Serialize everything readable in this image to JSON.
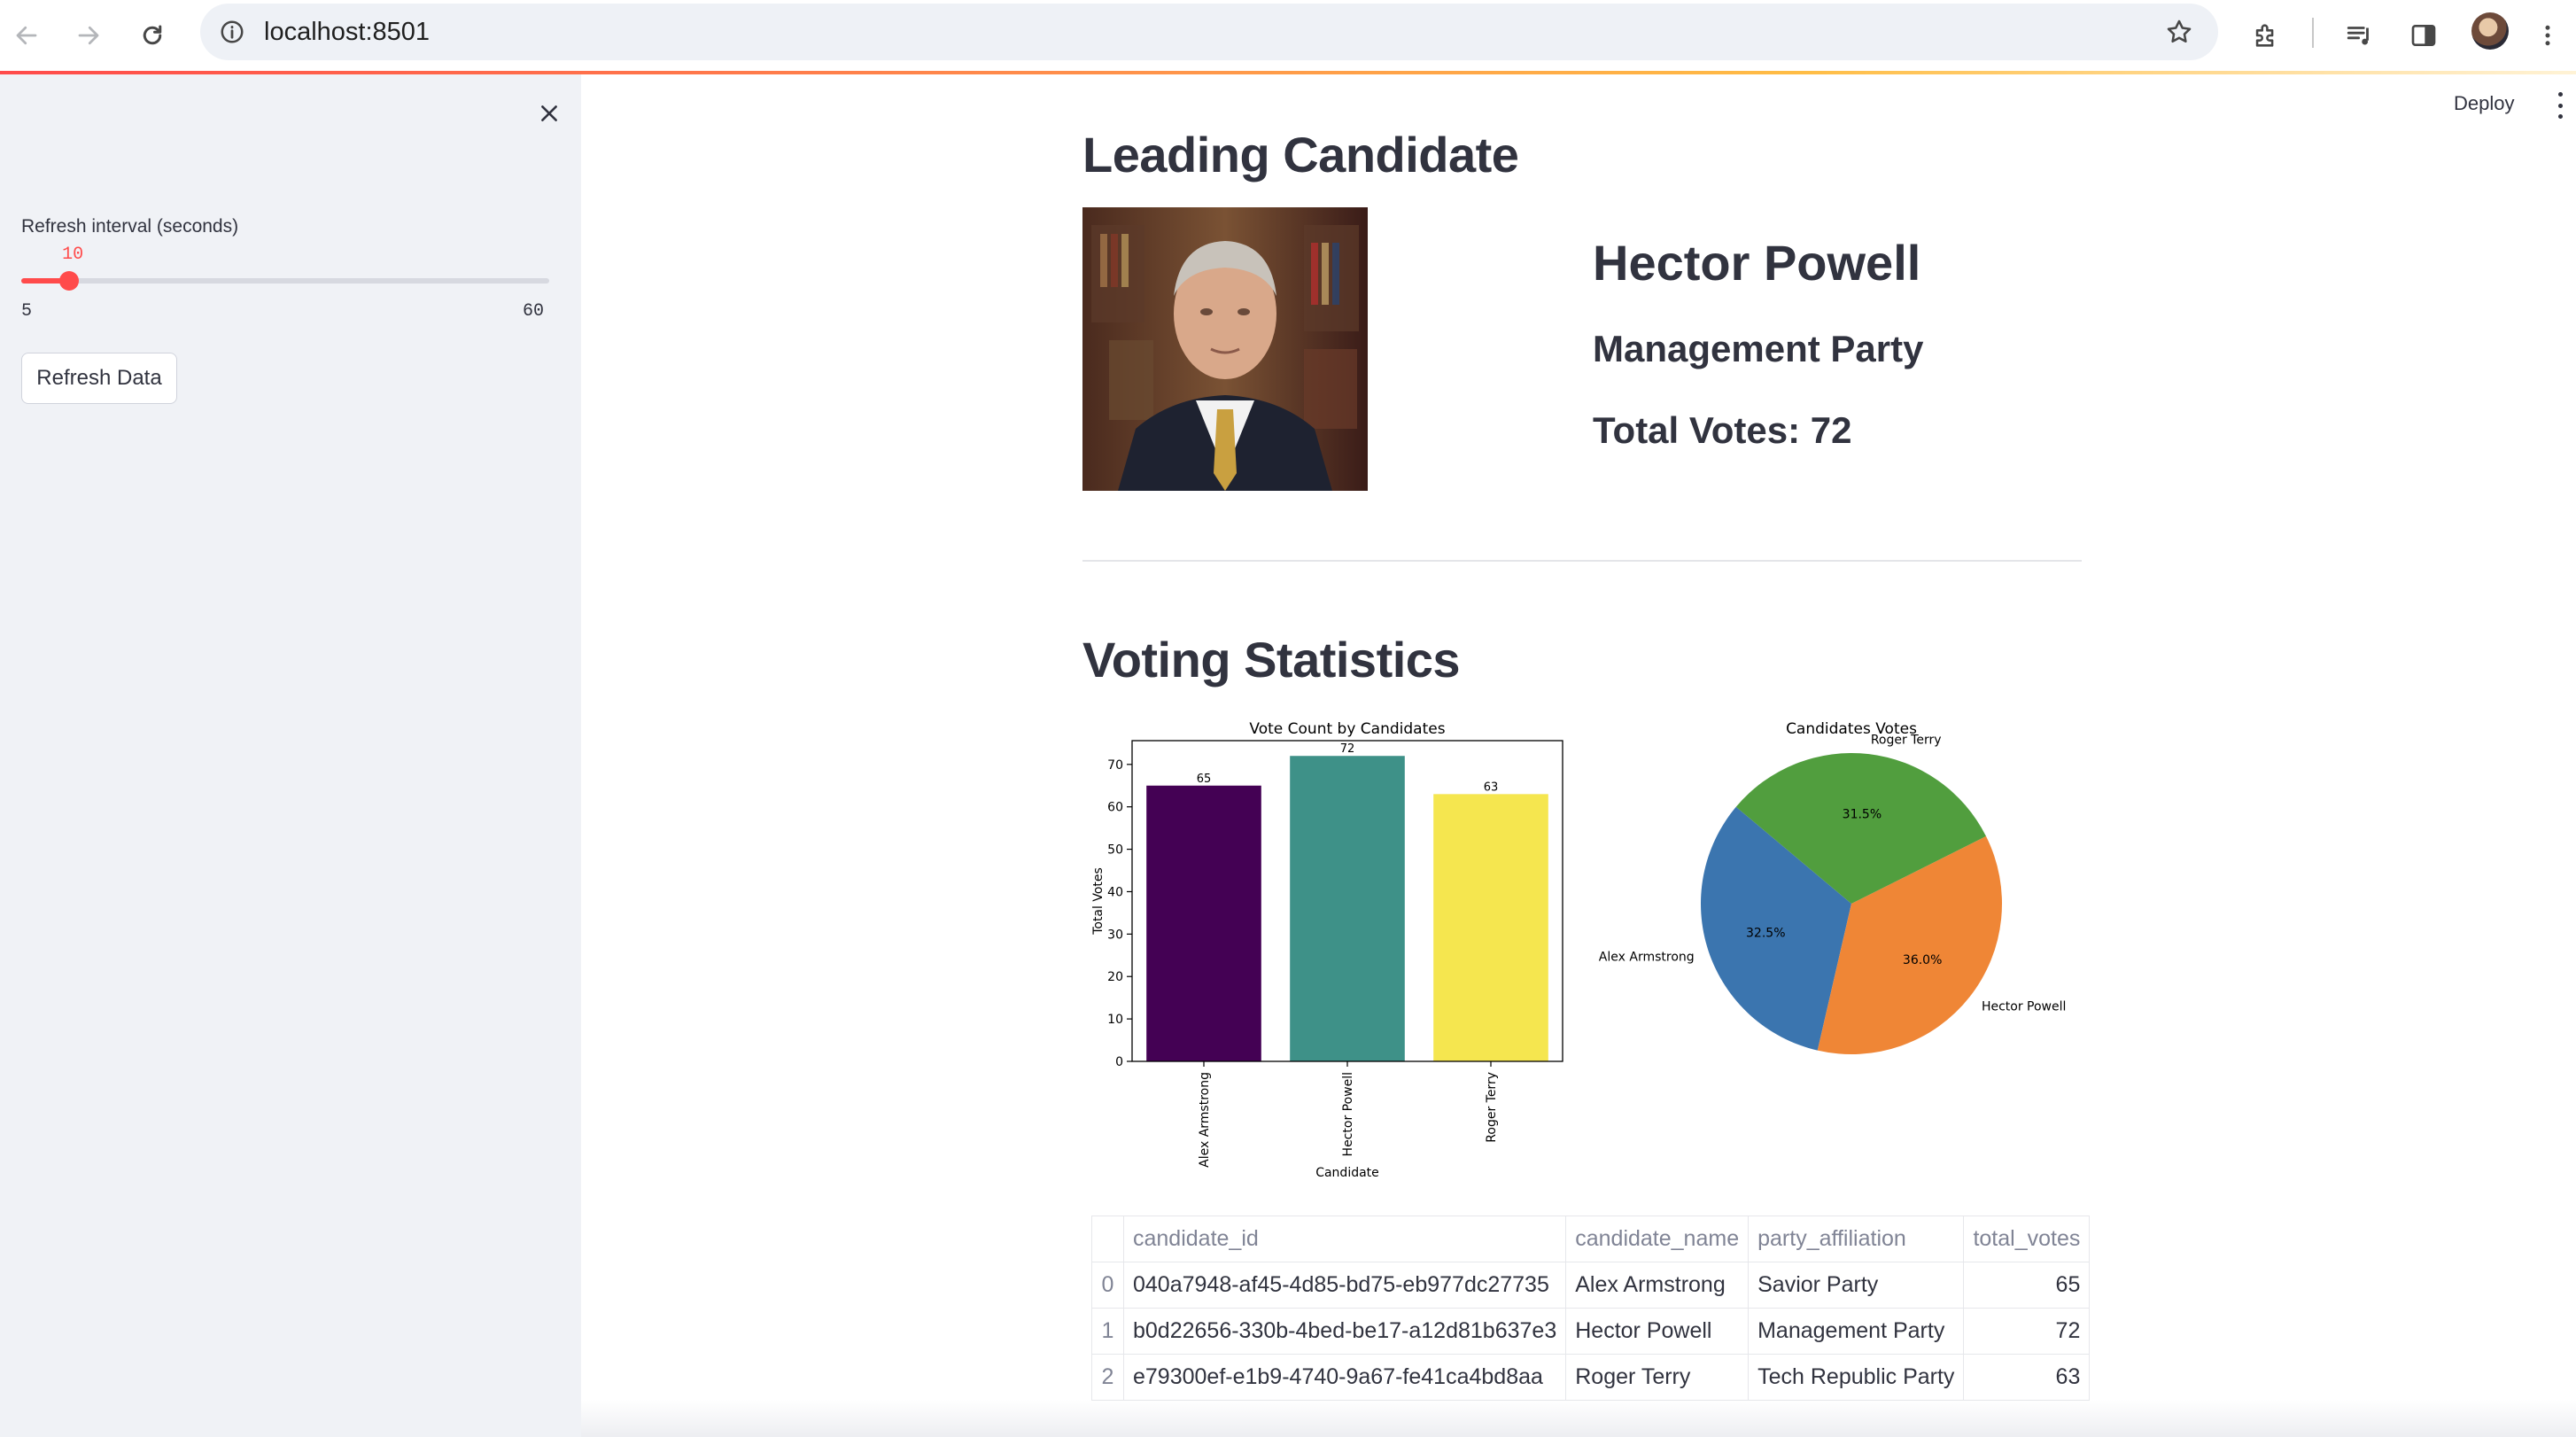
{
  "browser": {
    "url": "localhost:8501"
  },
  "sidebar": {
    "slider": {
      "label": "Refresh interval (seconds)",
      "value": 10,
      "value_text": "10",
      "min": 5,
      "max": 60,
      "min_text": "5",
      "max_text": "60"
    },
    "refresh_button": "Refresh Data"
  },
  "header": {
    "deploy_label": "Deploy"
  },
  "leading": {
    "heading": "Leading Candidate",
    "name": "Hector Powell",
    "party": "Management Party",
    "votes_text": "Total Votes: 72"
  },
  "stats": {
    "heading": "Voting Statistics"
  },
  "chart_data": [
    {
      "type": "bar",
      "title": "Vote Count by Candidates",
      "xlabel": "Candidate",
      "ylabel": "Total Votes",
      "categories": [
        "Alex Armstrong",
        "Hector Powell",
        "Roger Terry"
      ],
      "values": [
        65,
        72,
        63
      ],
      "value_labels": [
        "65",
        "72",
        "63"
      ],
      "colors": [
        "#440154",
        "#3e9188",
        "#f5e64f"
      ],
      "ylim": [
        0,
        75.6
      ],
      "yticks": [
        0,
        10,
        20,
        30,
        40,
        50,
        60,
        70
      ],
      "grid": false
    },
    {
      "type": "pie",
      "title": "Candidates Votes",
      "labels": [
        "Alex Armstrong",
        "Hector Powell",
        "Roger Terry"
      ],
      "values": [
        65,
        72,
        63
      ],
      "pct_labels": [
        "32.5%",
        "36.0%",
        "31.5%"
      ],
      "colors": [
        "#3b75af",
        "#ef8636",
        "#519e3e"
      ],
      "start_angle_deg": 140
    }
  ],
  "table": {
    "columns": [
      "",
      "candidate_id",
      "candidate_name",
      "party_affiliation",
      "total_votes"
    ],
    "rows": [
      {
        "index": "0",
        "candidate_id": "040a7948-af45-4d85-bd75-eb977dc27735",
        "candidate_name": "Alex Armstrong",
        "party_affiliation": "Savior Party",
        "total_votes": "65"
      },
      {
        "index": "1",
        "candidate_id": "b0d22656-330b-4bed-be17-a12d81b637e3",
        "candidate_name": "Hector Powell",
        "party_affiliation": "Management Party",
        "total_votes": "72"
      },
      {
        "index": "2",
        "candidate_id": "e79300ef-e1b9-4740-9a67-fe41ca4bd8aa",
        "candidate_name": "Roger Terry",
        "party_affiliation": "Tech Republic Party",
        "total_votes": "63"
      }
    ]
  }
}
